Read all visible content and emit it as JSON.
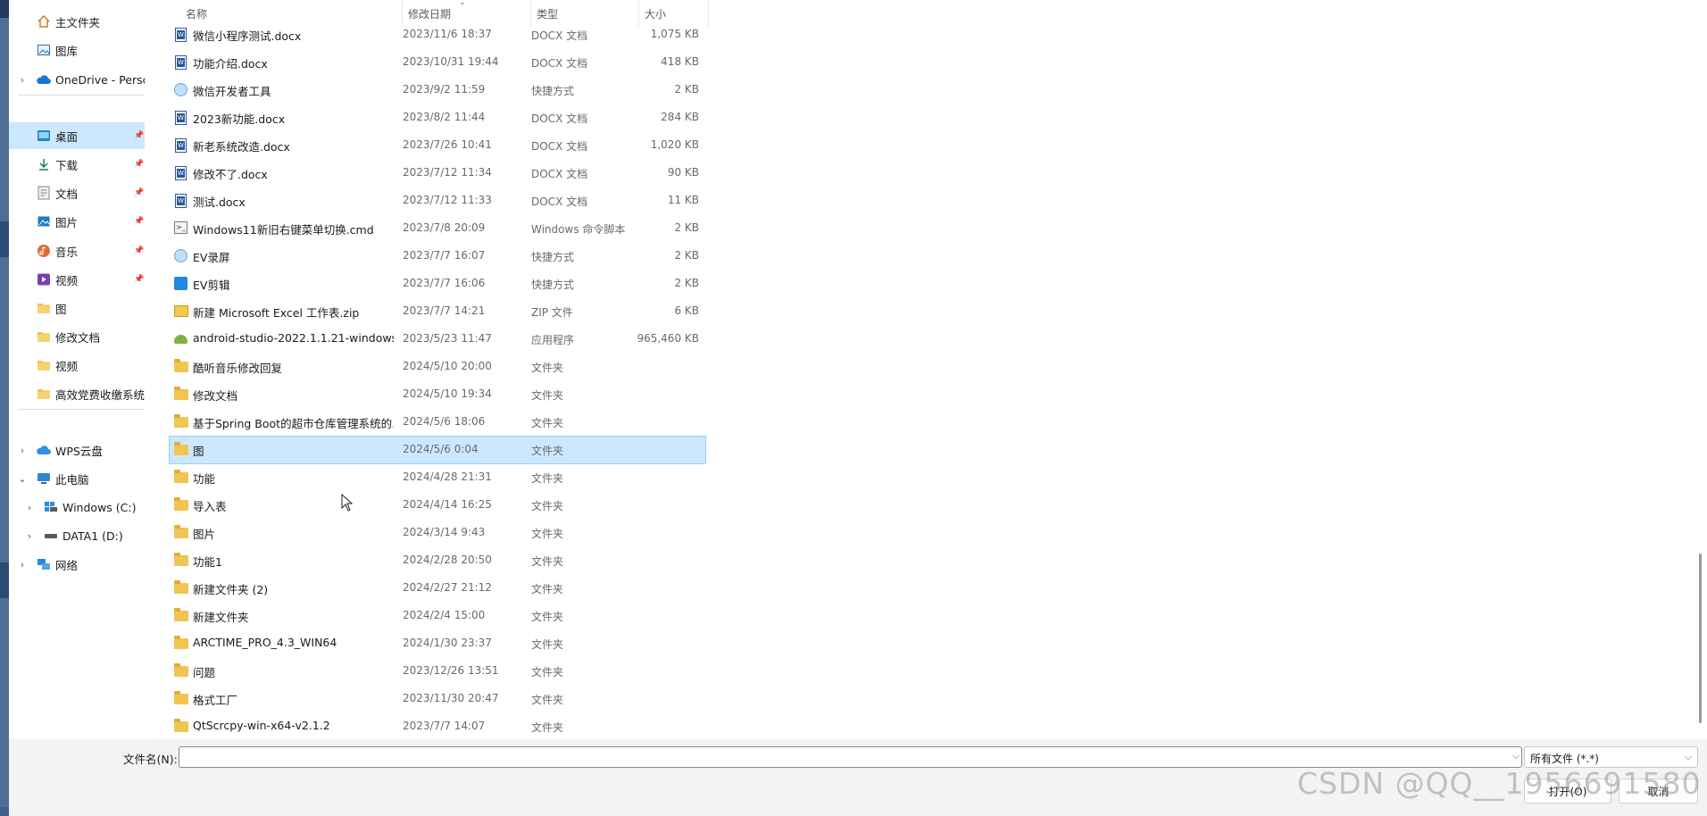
{
  "sidebar": {
    "items": [
      {
        "label": "主文件夹",
        "icon": "home-icon",
        "chevron": false,
        "pinned": false,
        "selected": false
      },
      {
        "label": "图库",
        "icon": "gallery-icon",
        "chevron": false,
        "pinned": false,
        "selected": false
      },
      {
        "label": "OneDrive - Perso",
        "icon": "onedrive-cloud-icon",
        "chevron": true,
        "pinned": false,
        "selected": false
      },
      {
        "label": "桌面",
        "icon": "desktop-icon",
        "chevron": false,
        "pinned": true,
        "selected": true
      },
      {
        "label": "下载",
        "icon": "download-icon",
        "chevron": false,
        "pinned": true,
        "selected": false
      },
      {
        "label": "文档",
        "icon": "documents-icon",
        "chevron": false,
        "pinned": true,
        "selected": false
      },
      {
        "label": "图片",
        "icon": "pictures-icon",
        "chevron": false,
        "pinned": true,
        "selected": false
      },
      {
        "label": "音乐",
        "icon": "music-icon",
        "chevron": false,
        "pinned": true,
        "selected": false
      },
      {
        "label": "视频",
        "icon": "videos-icon",
        "chevron": false,
        "pinned": true,
        "selected": false
      },
      {
        "label": "图",
        "icon": "folder-icon",
        "chevron": false,
        "pinned": false,
        "selected": false
      },
      {
        "label": "修改文档",
        "icon": "folder-icon",
        "chevron": false,
        "pinned": false,
        "selected": false
      },
      {
        "label": "视频",
        "icon": "folder-icon",
        "chevron": false,
        "pinned": false,
        "selected": false
      },
      {
        "label": "高效党费收缴系统f",
        "icon": "folder-icon",
        "chevron": false,
        "pinned": false,
        "selected": false
      },
      {
        "label": "WPS云盘",
        "icon": "wps-cloud-icon",
        "chevron": true,
        "pinned": false,
        "selected": false
      },
      {
        "label": "此电脑",
        "icon": "this-pc-icon",
        "chevron": true,
        "expanded": true,
        "pinned": false,
        "selected": false
      },
      {
        "label": "Windows (C:)",
        "icon": "windows-drive-icon",
        "chevron": true,
        "pinned": false,
        "selected": false
      },
      {
        "label": "DATA1 (D:)",
        "icon": "drive-icon",
        "chevron": true,
        "pinned": false,
        "selected": false
      },
      {
        "label": "网络",
        "icon": "network-icon",
        "chevron": true,
        "pinned": false,
        "selected": false
      }
    ],
    "pin_glyph": "📌"
  },
  "columns": {
    "name": "名称",
    "date": "修改日期",
    "type": "类型",
    "size": "大小"
  },
  "files": [
    {
      "name": "微信小程序测试.docx",
      "date": "2023/11/6 18:37",
      "type": "DOCX 文档",
      "size": "1,075 KB",
      "icon": "docx-icon"
    },
    {
      "name": "功能介绍.docx",
      "date": "2023/10/31 19:44",
      "type": "DOCX 文档",
      "size": "418 KB",
      "icon": "docx-icon"
    },
    {
      "name": "微信开发者工具",
      "date": "2023/9/2 11:59",
      "type": "快捷方式",
      "size": "2 KB",
      "icon": "shortcut-icon"
    },
    {
      "name": "2023新功能.docx",
      "date": "2023/8/2 11:44",
      "type": "DOCX 文档",
      "size": "284 KB",
      "icon": "docx-icon"
    },
    {
      "name": "新老系统改造.docx",
      "date": "2023/7/26 10:41",
      "type": "DOCX 文档",
      "size": "1,020 KB",
      "icon": "docx-icon"
    },
    {
      "name": "修改不了.docx",
      "date": "2023/7/12 11:34",
      "type": "DOCX 文档",
      "size": "90 KB",
      "icon": "docx-icon"
    },
    {
      "name": "测试.docx",
      "date": "2023/7/12 11:33",
      "type": "DOCX 文档",
      "size": "11 KB",
      "icon": "docx-icon"
    },
    {
      "name": "Windows11新旧右键菜单切换.cmd",
      "date": "2023/7/8 20:09",
      "type": "Windows 命令脚本",
      "size": "2 KB",
      "icon": "cmd-script-icon"
    },
    {
      "name": "EV录屏",
      "date": "2023/7/7 16:07",
      "type": "快捷方式",
      "size": "2 KB",
      "icon": "ev-recorder-icon"
    },
    {
      "name": "EV剪辑",
      "date": "2023/7/7 16:06",
      "type": "快捷方式",
      "size": "2 KB",
      "icon": "ev-editor-icon"
    },
    {
      "name": "新建 Microsoft Excel 工作表.zip",
      "date": "2023/7/7 14:21",
      "type": "ZIP 文件",
      "size": "6 KB",
      "icon": "zip-icon"
    },
    {
      "name": "android-studio-2022.1.1.21-windows....",
      "date": "2023/5/23 11:47",
      "type": "应用程序",
      "size": "965,460 KB",
      "icon": "android-app-icon"
    },
    {
      "name": "酷听音乐修改回复",
      "date": "2024/5/10 20:00",
      "type": "文件夹",
      "size": "",
      "icon": "folder-icon"
    },
    {
      "name": "修改文档",
      "date": "2024/5/10 19:34",
      "type": "文件夹",
      "size": "",
      "icon": "folder-icon"
    },
    {
      "name": "基于Spring Boot的超市仓库管理系统的...",
      "date": "2024/5/6 18:06",
      "type": "文件夹",
      "size": "",
      "icon": "folder-icon"
    },
    {
      "name": "图",
      "date": "2024/5/6 0:04",
      "type": "文件夹",
      "size": "",
      "icon": "folder-icon",
      "selected": true
    },
    {
      "name": "功能",
      "date": "2024/4/28 21:31",
      "type": "文件夹",
      "size": "",
      "icon": "folder-icon"
    },
    {
      "name": "导入表",
      "date": "2024/4/14 16:25",
      "type": "文件夹",
      "size": "",
      "icon": "folder-icon"
    },
    {
      "name": "图片",
      "date": "2024/3/14 9:43",
      "type": "文件夹",
      "size": "",
      "icon": "folder-icon"
    },
    {
      "name": "功能1",
      "date": "2024/2/28 20:50",
      "type": "文件夹",
      "size": "",
      "icon": "folder-icon"
    },
    {
      "name": "新建文件夹 (2)",
      "date": "2024/2/27 21:12",
      "type": "文件夹",
      "size": "",
      "icon": "folder-icon"
    },
    {
      "name": "新建文件夹",
      "date": "2024/2/4 15:00",
      "type": "文件夹",
      "size": "",
      "icon": "folder-icon"
    },
    {
      "name": "ARCTIME_PRO_4.3_WIN64",
      "date": "2024/1/30 23:37",
      "type": "文件夹",
      "size": "",
      "icon": "folder-icon"
    },
    {
      "name": "问题",
      "date": "2023/12/26 13:51",
      "type": "文件夹",
      "size": "",
      "icon": "folder-icon"
    },
    {
      "name": "格式工厂",
      "date": "2023/11/30 20:47",
      "type": "文件夹",
      "size": "",
      "icon": "folder-icon"
    },
    {
      "name": "QtScrcpy-win-x64-v2.1.2",
      "date": "2023/7/7 14:07",
      "type": "文件夹",
      "size": "",
      "icon": "folder-icon"
    }
  ],
  "footer": {
    "filename_label": "文件名(N):",
    "filename_value": "",
    "filetype_value": "所有文件 (*.*)",
    "open_button": "打开(O)",
    "cancel_button": "取消"
  },
  "watermark": "CSDN @QQ__1956691580",
  "colors": {
    "selection_bg": "#cce8ff",
    "selection_border": "#99d1ff",
    "folder": "#f0c552",
    "docx": "#2b579a",
    "desktop_edge": "#4f6e95"
  }
}
